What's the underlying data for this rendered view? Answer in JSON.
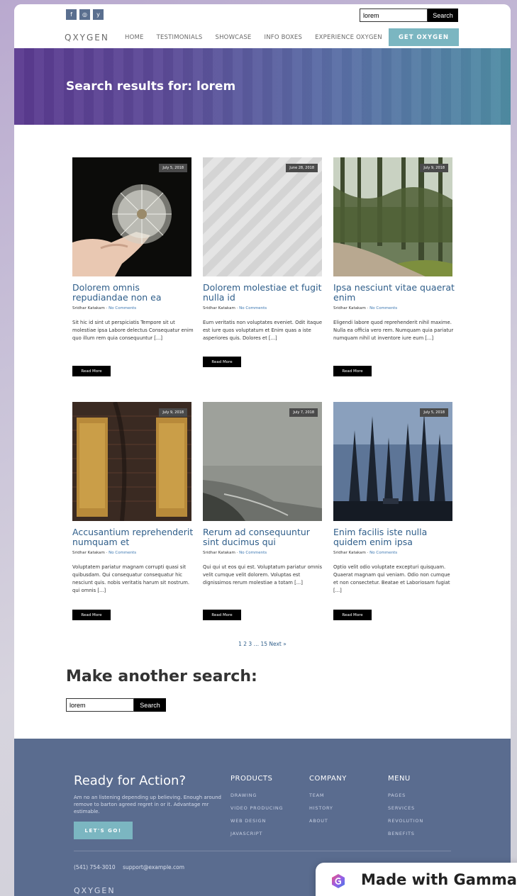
{
  "header": {
    "social": [
      "f",
      "◎",
      "y"
    ],
    "search_value": "lorem",
    "search_button": "Search",
    "logo": "QXYGEN",
    "nav": [
      "HOME",
      "TESTIMONIALS",
      "SHOWCASE",
      "INFO BOXES",
      "EXPERIENCE OXYGEN"
    ],
    "cta": "GET OXYGEN"
  },
  "hero": {
    "title": "Search results for: lorem"
  },
  "cards": [
    {
      "date": "July 5, 2018",
      "title": "Dolorem omnis repudiandae non ea",
      "author": "Sridhar Katakam",
      "comments": "No Comments",
      "excerpt": "Sit hic id sint ut perspiciatis Tempore sit ut molestiae ipsa Labore delectus Consequatur enim quo illum rem quia consequuntur [...]",
      "read_more": "Read More"
    },
    {
      "date": "June 28, 2018",
      "title": "Dolorem molestiae et fugit nulla id",
      "author": "Sridhar Katakam",
      "comments": "No Comments",
      "excerpt": "Eum veritatis non voluptates eveniet. Odit itaque est iure quos voluptatum et Enim quas a iste asperiores quis. Dolores et [...]",
      "read_more": "Read More"
    },
    {
      "date": "July 9, 2018",
      "title": "Ipsa nesciunt vitae quaerat enim",
      "author": "Sridhar Katakam",
      "comments": "No Comments",
      "excerpt": "Eligendi labore quod reprehenderit nihil maxime. Nulla ea officia vero rem. Numquam quia pariatur numquam nihil ut inventore iure eum [...]",
      "read_more": "Read More"
    },
    {
      "date": "July 9, 2018",
      "title": "Accusantium reprehenderit numquam et",
      "author": "Sridhar Katakam",
      "comments": "No Comments",
      "excerpt": "Voluptatem pariatur magnam corrupti quasi sit quibusdam. Qui consequatur consequatur hic nesciunt quis. nobis veritatis harum sit nostrum. qui omnis [...]",
      "read_more": "Read More"
    },
    {
      "date": "July 7, 2018",
      "title": "Rerum ad consequuntur sint ducimus qui",
      "author": "Sridhar Katakam",
      "comments": "No Comments",
      "excerpt": "Qui qui ut eos qui est. Voluptatum pariatur omnis velit cumque velit dolorem. Voluptas est dignissimos rerum molestiae a totam [...]",
      "read_more": "Read More"
    },
    {
      "date": "July 5, 2018",
      "title": "Enim facilis iste nulla quidem enim ipsa",
      "author": "Sridhar Katakam",
      "comments": "No Comments",
      "excerpt": "Optio velit odio voluptate excepturi quisquam. Quaerat magnam qui veniam. Odio non cumque et non consectetur. Beatae et Laboriosam fugiat [...]",
      "read_more": "Read More"
    }
  ],
  "pagination": "1 2 3 … 15 Next »",
  "search_again": {
    "title": "Make another search:",
    "value": "lorem",
    "button": "Search"
  },
  "footer": {
    "title": "Ready for Action?",
    "text": "Am no an listening depending up believing. Enough around remove to barton agreed regret in or it. Advantage mr estimable.",
    "button": "LET'S GO!",
    "columns": [
      {
        "heading": "PRODUCTS",
        "items": [
          "DRAWING",
          "VIDEO PRODUCING",
          "WEB DESIGN",
          "JAVASCRIPT"
        ]
      },
      {
        "heading": "COMPANY",
        "items": [
          "TEAM",
          "HISTORY",
          "ABOUT"
        ]
      },
      {
        "heading": "MENU",
        "items": [
          "PAGES",
          "SERVICES",
          "REVOLUTION",
          "BENEFITS"
        ]
      }
    ],
    "phone": "(541) 754-3010",
    "email": "support@example.com",
    "logo": "QXYGEN"
  },
  "badge": {
    "text": "Made with Gamma"
  }
}
